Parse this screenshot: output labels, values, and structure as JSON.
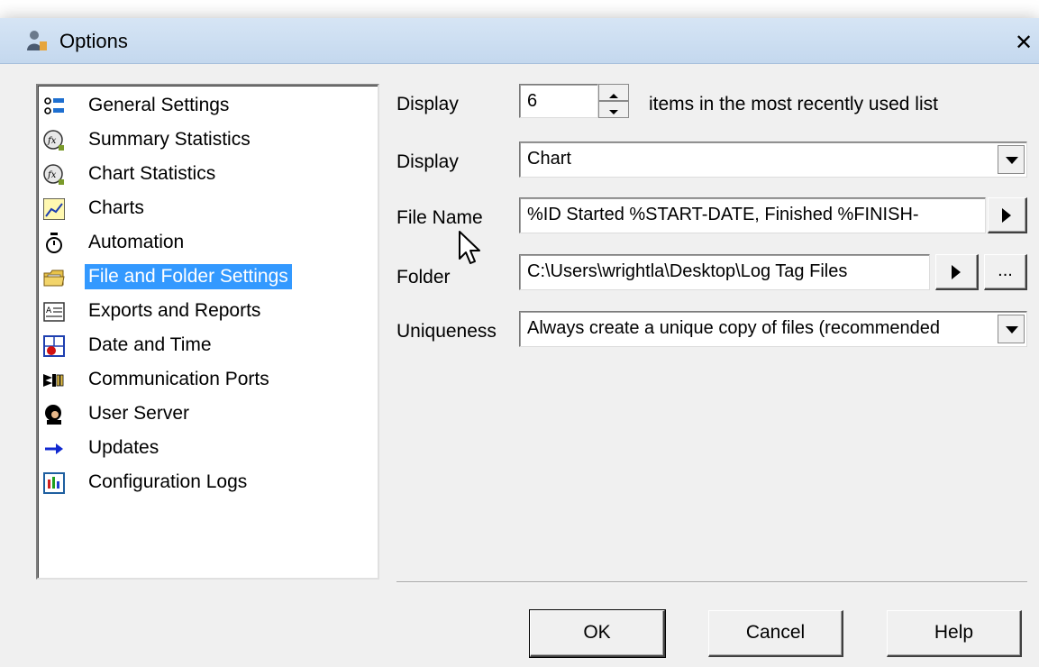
{
  "window": {
    "title": "Options",
    "close_symbol": "✕"
  },
  "tree": {
    "items": [
      {
        "label": "General Settings",
        "icon": "general-settings-icon"
      },
      {
        "label": "Summary Statistics",
        "icon": "statistics-icon"
      },
      {
        "label": "Chart Statistics",
        "icon": "statistics-icon"
      },
      {
        "label": "Charts",
        "icon": "chart-icon"
      },
      {
        "label": "Automation",
        "icon": "stopwatch-icon"
      },
      {
        "label": "File and Folder Settings",
        "icon": "folder-icon",
        "selected": true
      },
      {
        "label": "Exports and Reports",
        "icon": "report-icon"
      },
      {
        "label": "Date and Time",
        "icon": "calendar-icon"
      },
      {
        "label": "Communication Ports",
        "icon": "ports-icon"
      },
      {
        "label": "User Server",
        "icon": "user-server-icon"
      },
      {
        "label": "Updates",
        "icon": "arrow-right-icon"
      },
      {
        "label": "Configuration Logs",
        "icon": "log-icon"
      }
    ]
  },
  "settings": {
    "mru": {
      "label": "Display",
      "value": "6",
      "suffix": "items in the most recently used list"
    },
    "display": {
      "label": "Display",
      "value": "Chart"
    },
    "file_name": {
      "label": "File Name",
      "value": "%ID Started %START-DATE, Finished %FINISH-"
    },
    "folder": {
      "label": "Folder",
      "value": "C:\\Users\\wrightla\\Desktop\\Log Tag Files",
      "browse_label": "..."
    },
    "uniqueness": {
      "label": "Uniqueness",
      "value": "Always create a unique copy of files (recommended"
    }
  },
  "buttons": {
    "ok": "OK",
    "cancel": "Cancel",
    "help": "Help"
  },
  "colors": {
    "selection": "#3399ff",
    "titlebar": "#c4d8ee",
    "dialog_bg": "#f0f0f0"
  }
}
